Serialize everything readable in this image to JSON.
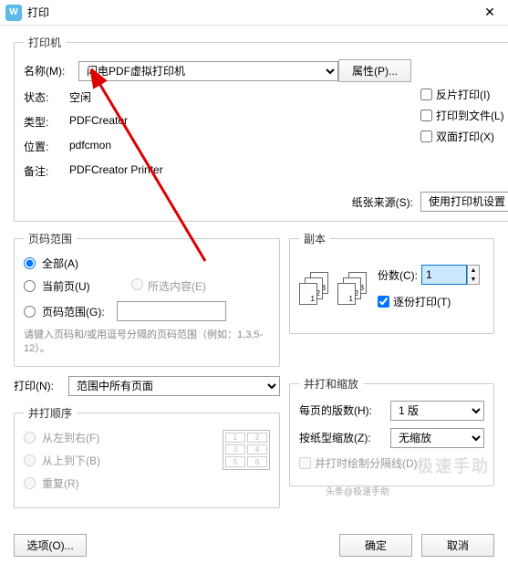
{
  "titlebar": {
    "title": "打印"
  },
  "printer_group": {
    "legend": "打印机",
    "name_label": "名称(M):",
    "name_value": "闪电PDF虚拟打印机",
    "props_btn": "属性(P)...",
    "status_label": "状态:",
    "status_value": "空闲",
    "type_label": "类型:",
    "type_value": "PDFCreator",
    "where_label": "位置:",
    "where_value": "pdfcmon",
    "comment_label": "备注:",
    "comment_value": "PDFCreator Printer",
    "reverse_chk": "反片打印(I)",
    "tofile_chk": "打印到文件(L)",
    "duplex_chk": "双面打印(X)",
    "paper_src_label": "纸张来源(S):",
    "paper_src_value": "使用打印机设置"
  },
  "range_group": {
    "legend": "页码范围",
    "all": "全部(A)",
    "current": "当前页(U)",
    "selection": "所选内容(E)",
    "pages_label": "页码范围(G):",
    "pages_value": "",
    "hint": "请键入页码和/或用逗号分隔的页码范围（例如：1,3,5-12）。"
  },
  "copies_group": {
    "legend": "副本",
    "copies_label": "份数(C):",
    "copies_value": "1",
    "collate": "逐份打印(T)"
  },
  "print_what_label": "打印(N):",
  "print_what_value": "范围中所有页面",
  "order_group": {
    "legend": "并打顺序",
    "lr": "从左到右(F)",
    "tb": "从上到下(B)",
    "repeat": "重复(R)"
  },
  "scale_group": {
    "legend": "并打和缩放",
    "per_sheet_label": "每页的版数(H):",
    "per_sheet_value": "1 版",
    "scale_label": "按纸型缩放(Z):",
    "scale_value": "无缩放",
    "draw_border": "并打时绘制分隔线(D)"
  },
  "footer": {
    "options": "选项(O)...",
    "ok": "确定",
    "cancel": "取消"
  },
  "watermark": "极速手助",
  "toutiao": "头条@极速手助"
}
